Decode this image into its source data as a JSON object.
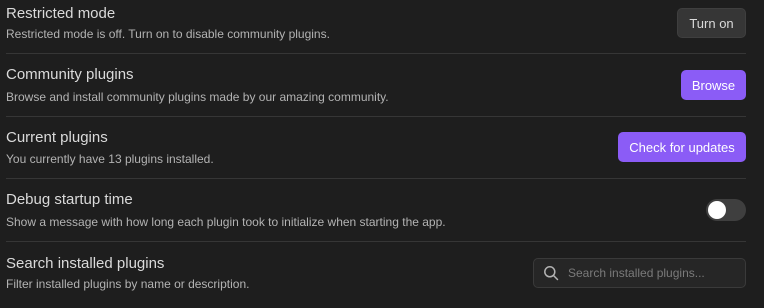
{
  "settings": {
    "restricted_mode": {
      "name": "Restricted mode",
      "description": "Restricted mode is off. Turn on to disable community plugins.",
      "button_label": "Turn on"
    },
    "community_plugins": {
      "name": "Community plugins",
      "description": "Browse and install community plugins made by our amazing community.",
      "button_label": "Browse"
    },
    "current_plugins": {
      "name": "Current plugins",
      "description": "You currently have 13 plugins installed.",
      "button_label": "Check for updates"
    },
    "debug_startup_time": {
      "name": "Debug startup time",
      "description": "Show a message with how long each plugin took to initialize when starting the app.",
      "toggle_enabled": false
    },
    "search_installed_plugins": {
      "name": "Search installed plugins",
      "description": "Filter installed plugins by name or description.",
      "placeholder": "Search installed plugins...",
      "value": ""
    }
  },
  "colors": {
    "background": "#1e1e1e",
    "accent": "#8b5cf6",
    "secondary_button": "#363636",
    "toggle_off": "#3f3f3f"
  },
  "icons": {
    "search": "search-icon"
  }
}
